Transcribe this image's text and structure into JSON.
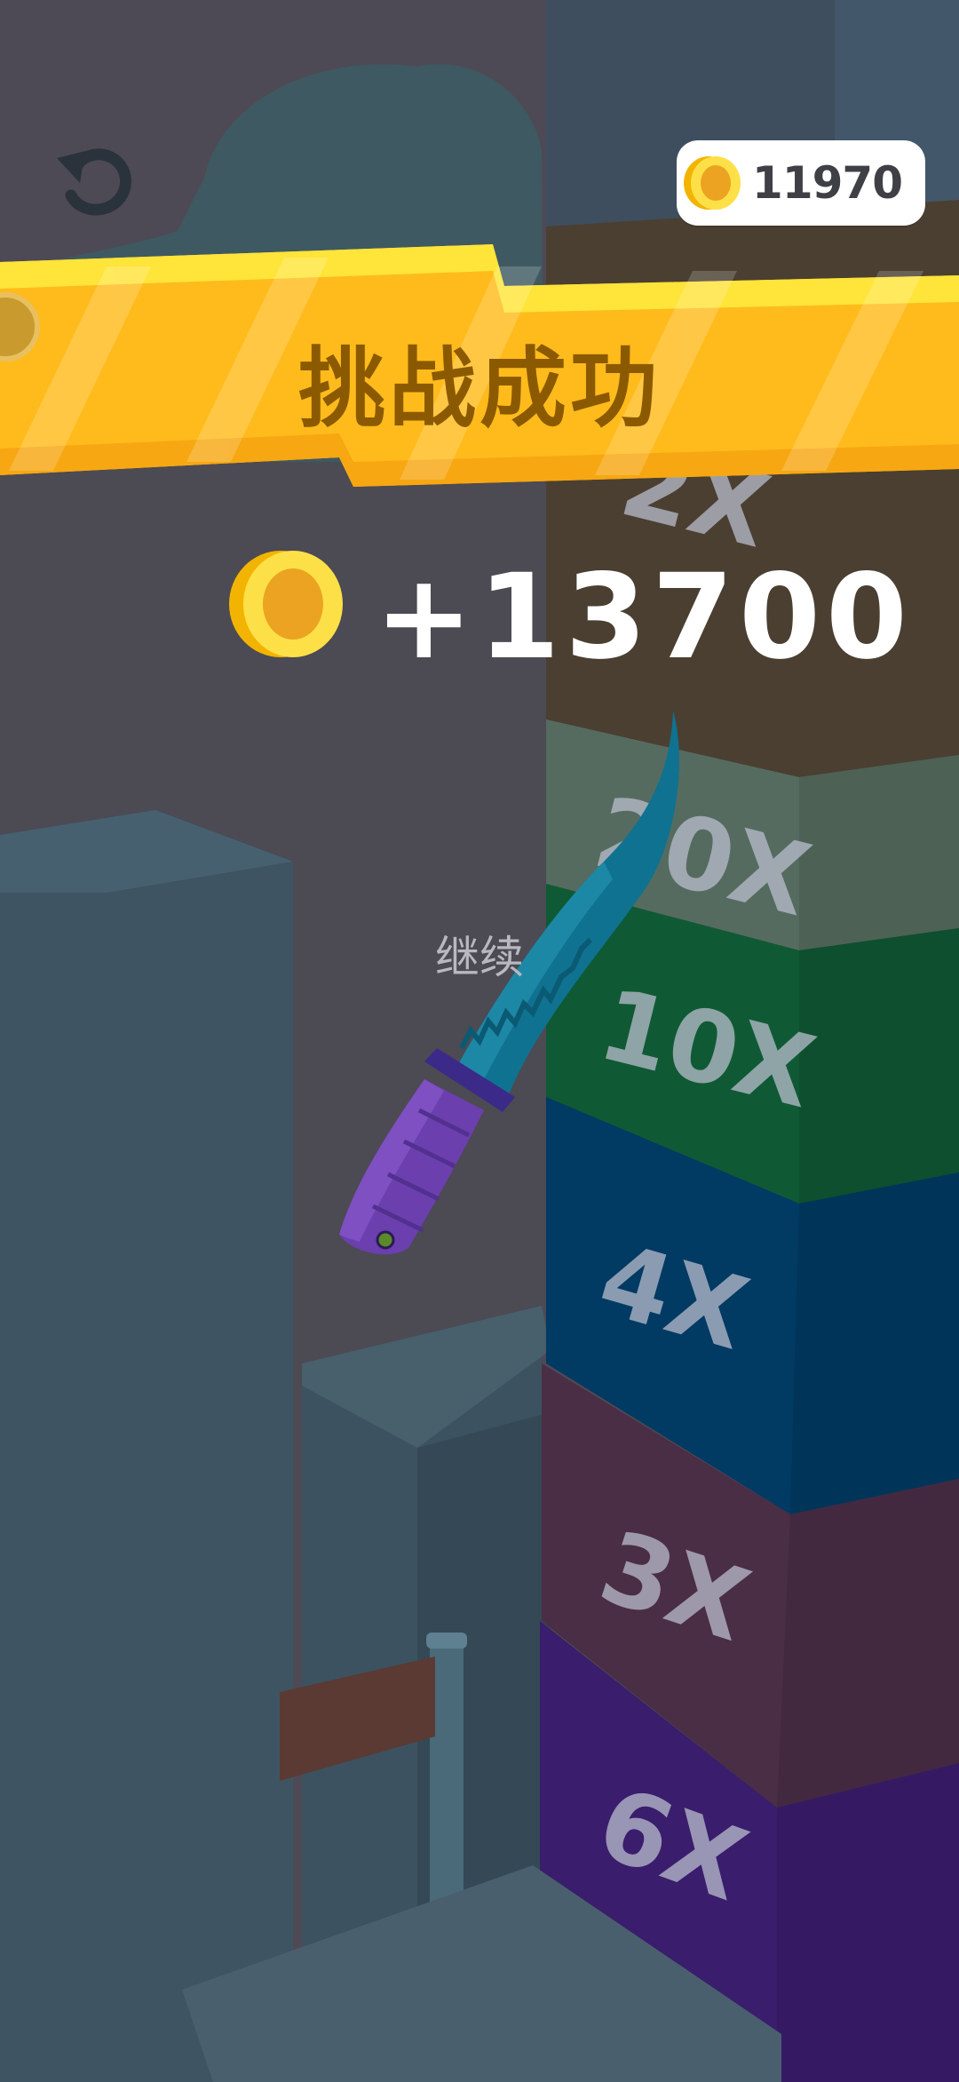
{
  "header": {
    "coin_balance": "11970"
  },
  "banner": {
    "title": "挑战成功"
  },
  "reward": {
    "amount": "+13700"
  },
  "actions": {
    "continue_label": "继续"
  },
  "tower": {
    "multipliers": [
      "2X",
      "20X",
      "10X",
      "4X",
      "3X",
      "6X"
    ]
  },
  "colors": {
    "banner_yellow": "#ffc21a",
    "coin_gold": "#f9c719",
    "tower_green": "#0f5a34",
    "tower_blue": "#003a62",
    "tower_maroon": "#4a2e45",
    "tower_purple": "#3b1d6e"
  },
  "icons": {
    "restart": "restart-icon",
    "coin": "coin-icon",
    "knife": "knife"
  }
}
